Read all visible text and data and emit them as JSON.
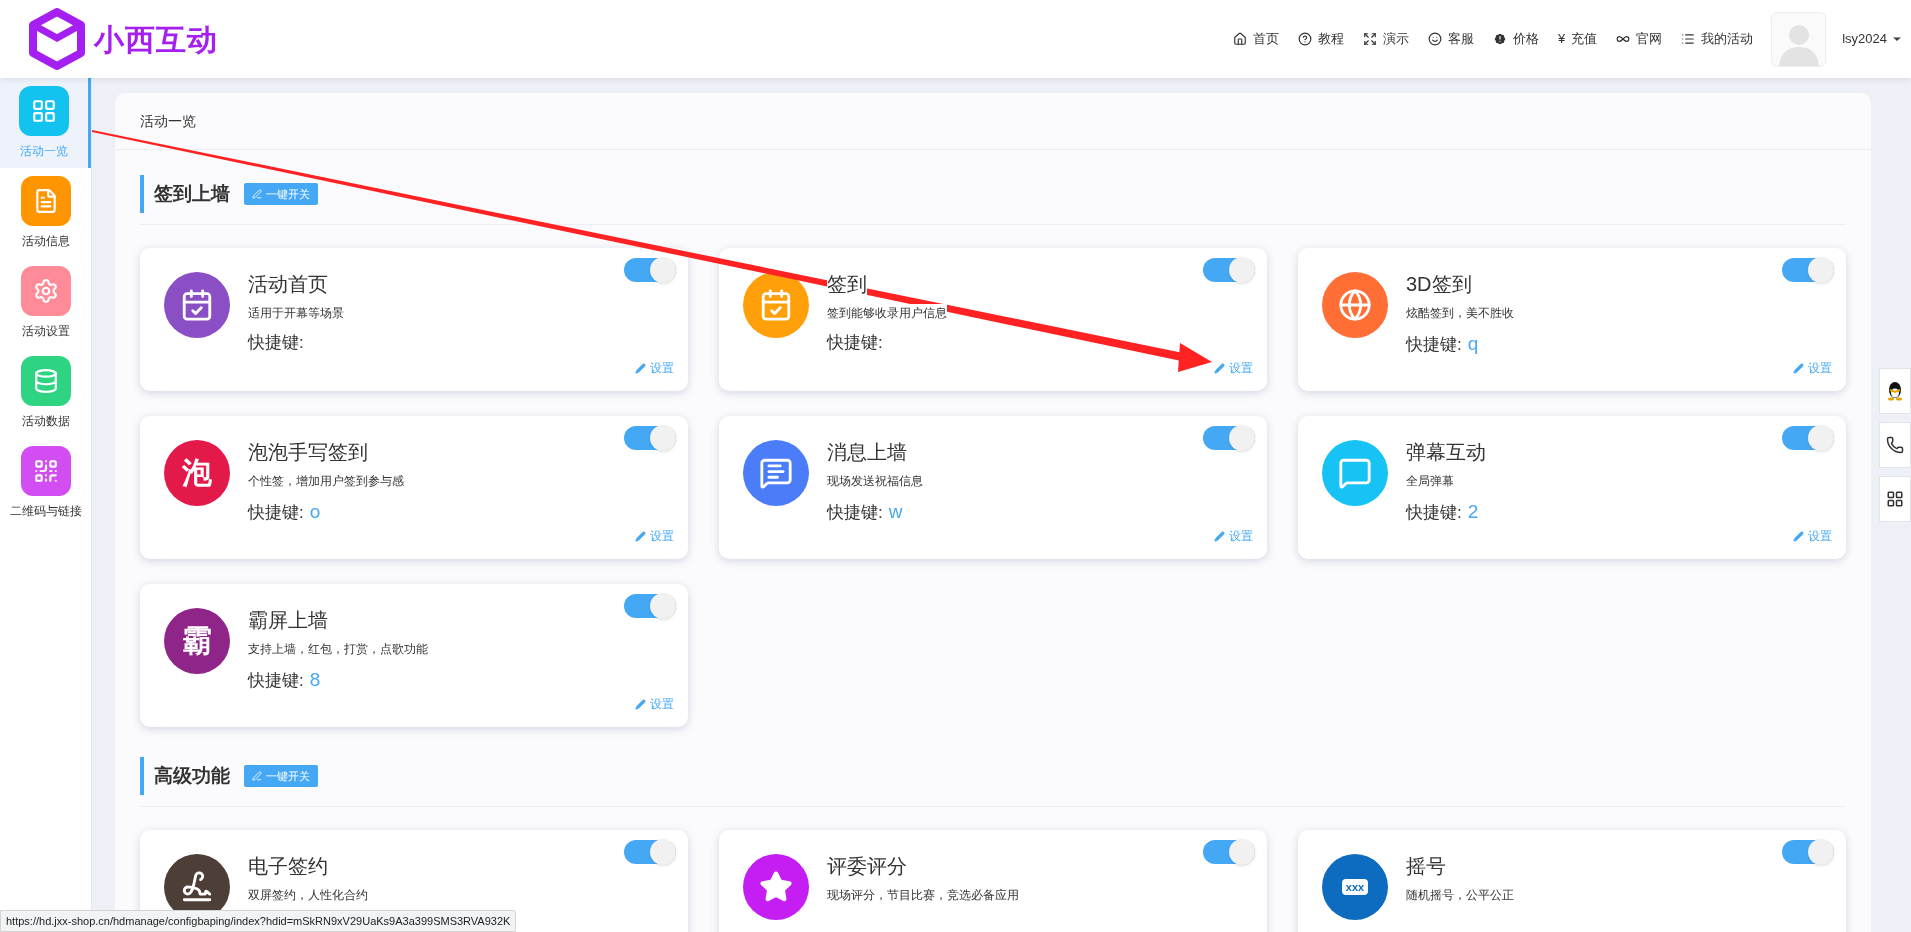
{
  "logo": {
    "text": "小西互动"
  },
  "nav": [
    {
      "kind": "home",
      "label": "首页"
    },
    {
      "kind": "help",
      "label": "教程"
    },
    {
      "kind": "expand",
      "label": "演示"
    },
    {
      "kind": "smile",
      "label": "客服"
    },
    {
      "kind": "alert",
      "label": "价格"
    },
    {
      "kind": "glyph",
      "glyph": "¥",
      "label": "充值"
    },
    {
      "kind": "infinity",
      "label": "官网"
    },
    {
      "kind": "list",
      "label": "我的活动"
    }
  ],
  "user": {
    "name": "lsy2024"
  },
  "sidebar": {
    "items": [
      {
        "kind": "grid",
        "label": "活动一览",
        "color": "#12c2ef",
        "selected": true
      },
      {
        "kind": "file",
        "label": "活动信息",
        "color": "#ff9500",
        "selected": false
      },
      {
        "kind": "gear",
        "label": "活动设置",
        "color": "#ff8b98",
        "selected": false
      },
      {
        "kind": "database",
        "label": "活动数据",
        "color": "#2fd483",
        "selected": false
      },
      {
        "kind": "qr",
        "label": "二维码与链接",
        "color": "#d24ef2",
        "selected": false
      }
    ]
  },
  "panel": {
    "title": "活动一览",
    "sections": [
      {
        "title": "签到上墙",
        "toggle_all": "一键开关",
        "cards": [
          {
            "kind": "calendar",
            "color": "#8a4fc4",
            "title": "活动首页",
            "desc": "适用于开幕等场景",
            "shortcut_label": "快捷键:",
            "on": true,
            "setting": "设置"
          },
          {
            "kind": "calendar",
            "color": "#ff9f0a",
            "title": "签到",
            "desc": "签到能够收录用户信息",
            "shortcut_label": "快捷键:",
            "on": true,
            "setting": "设置"
          },
          {
            "kind": "globe",
            "color": "#ff6f35",
            "title": "3D签到",
            "desc": "炫酷签到，美不胜收",
            "shortcut_label": "快捷键:",
            "shortcut_key": "q",
            "on": true,
            "setting": "设置"
          },
          {
            "kind": "char",
            "glyph": "泡",
            "color": "#e3194a",
            "title": "泡泡手写签到",
            "desc": "个性签，增加用户签到参与感",
            "shortcut_label": "快捷键:",
            "shortcut_key": "o",
            "on": true,
            "setting": "设置"
          },
          {
            "kind": "message",
            "color": "#4a7df7",
            "title": "消息上墙",
            "desc": "现场发送祝福信息",
            "shortcut_label": "快捷键:",
            "shortcut_key": "w",
            "on": true,
            "setting": "设置"
          },
          {
            "kind": "danmaku",
            "color": "#17c2f5",
            "title": "弹幕互动",
            "desc": "全局弹幕",
            "shortcut_label": "快捷键:",
            "shortcut_key": "2",
            "on": true,
            "setting": "设置"
          },
          {
            "kind": "char",
            "glyph": "霸",
            "color": "#8f2489",
            "title": "霸屏上墙",
            "desc": "支持上墙，红包，打赏，点歌功能",
            "shortcut_label": "快捷键:",
            "shortcut_key": "8",
            "on": true,
            "setting": "设置"
          }
        ]
      },
      {
        "title": "高级功能",
        "toggle_all": "一键开关",
        "cards": [
          {
            "kind": "signature",
            "color": "#4d3f37",
            "title": "电子签约",
            "desc": "双屏签约，人性化合约",
            "on": true
          },
          {
            "kind": "star",
            "color": "#c41ef2",
            "title": "评委评分",
            "desc": "现场评分，节目比赛，竞选必备应用",
            "on": true
          },
          {
            "kind": "box",
            "glyph": "xxx",
            "color": "#0d6cbf",
            "title": "摇号",
            "desc": "随机摇号，公平公正",
            "on": true
          }
        ]
      }
    ]
  },
  "status_url": "https://hd.jxx-shop.cn/hdmanage/configbaping/index?hdid=mSkRN9xV29UaKs9A3a399SMS3RVA932K"
}
